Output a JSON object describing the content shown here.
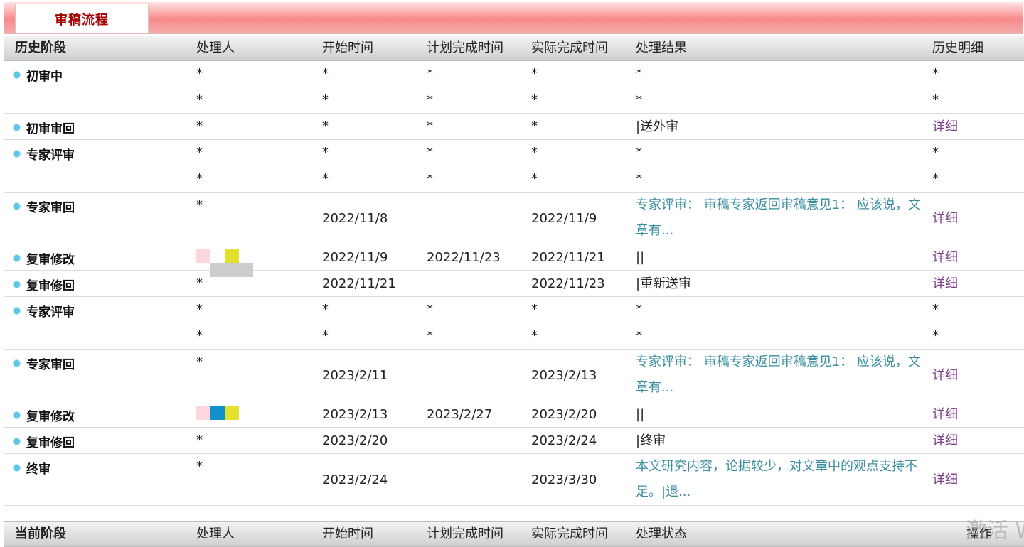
{
  "tab": {
    "title": "审稿流程"
  },
  "history_headers": [
    "历史阶段",
    "处理人",
    "开始时间",
    "计划完成时间",
    "实际完成时间",
    "处理结果",
    "历史明细"
  ],
  "history": [
    {
      "stage": "初审中",
      "rows": [
        {
          "handler": "*",
          "start": "*",
          "plan": "*",
          "actual": "*",
          "result": "*",
          "detail": "*"
        },
        {
          "handler": "*",
          "start": "*",
          "plan": "*",
          "actual": "*",
          "result": "*",
          "detail": "*"
        }
      ]
    },
    {
      "stage": "初审审回",
      "rows": [
        {
          "handler": "*",
          "start": "*",
          "plan": "*",
          "actual": "*",
          "result": "|送外审",
          "detail": "详细"
        }
      ]
    },
    {
      "stage": "专家评审",
      "rows": [
        {
          "handler": "*",
          "start": "*",
          "plan": "*",
          "actual": "*",
          "result": "*",
          "detail": "*"
        },
        {
          "handler": "*",
          "start": "*",
          "plan": "*",
          "actual": "*",
          "result": "*",
          "detail": "*"
        }
      ]
    },
    {
      "stage": "专家审回",
      "rows": [
        {
          "handler": "*",
          "start": "2022/11/8",
          "plan": "",
          "actual": "2022/11/9",
          "result": "专家评审： 审稿专家返回审稿意见1： 应该说，文章有...",
          "detail": "详细"
        }
      ]
    },
    {
      "stage": "复审修改",
      "rows": [
        {
          "handler": "",
          "start": "2022/11/9",
          "plan": "2022/11/23",
          "actual": "2022/11/21",
          "result": "||",
          "detail": "详细"
        }
      ]
    },
    {
      "stage": "复审修回",
      "rows": [
        {
          "handler": "*",
          "start": "2022/11/21",
          "plan": "",
          "actual": "2022/11/23",
          "result": "|重新送审",
          "detail": "详细"
        }
      ]
    },
    {
      "stage": "专家评审",
      "rows": [
        {
          "handler": "*",
          "start": "*",
          "plan": "*",
          "actual": "*",
          "result": "*",
          "detail": "*"
        },
        {
          "handler": "*",
          "start": "*",
          "plan": "*",
          "actual": "*",
          "result": "*",
          "detail": "*"
        }
      ]
    },
    {
      "stage": "专家审回",
      "rows": [
        {
          "handler": "*",
          "start": "2023/2/11",
          "plan": "",
          "actual": "2023/2/13",
          "result": "专家评审： 审稿专家返回审稿意见1： 应该说，文章有...",
          "detail": "详细"
        }
      ]
    },
    {
      "stage": "复审修改",
      "rows": [
        {
          "handler": "",
          "start": "2023/2/13",
          "plan": "2023/2/27",
          "actual": "2023/2/20",
          "result": "||",
          "detail": "详细"
        }
      ]
    },
    {
      "stage": "复审修回",
      "rows": [
        {
          "handler": "*",
          "start": "2023/2/20",
          "plan": "",
          "actual": "2023/2/24",
          "result": "|终审",
          "detail": "详细"
        }
      ]
    },
    {
      "stage": "终审",
      "rows": [
        {
          "handler": "*",
          "start": "2023/2/24",
          "plan": "",
          "actual": "2023/3/30",
          "result": "本文研究内容，论据较少，对文章中的观点支持不足。|退...",
          "detail": "详细"
        }
      ]
    }
  ],
  "current_headers": [
    "当前阶段",
    "处理人",
    "开始时间",
    "计划完成时间",
    "实际完成时间",
    "处理状态",
    "操作"
  ],
  "watermark": "激活 W",
  "colors": {
    "link": "#7a3e8a",
    "teal": "#3a8ea0",
    "dot": "#5fc6e6",
    "tab_text": "#a30000"
  }
}
